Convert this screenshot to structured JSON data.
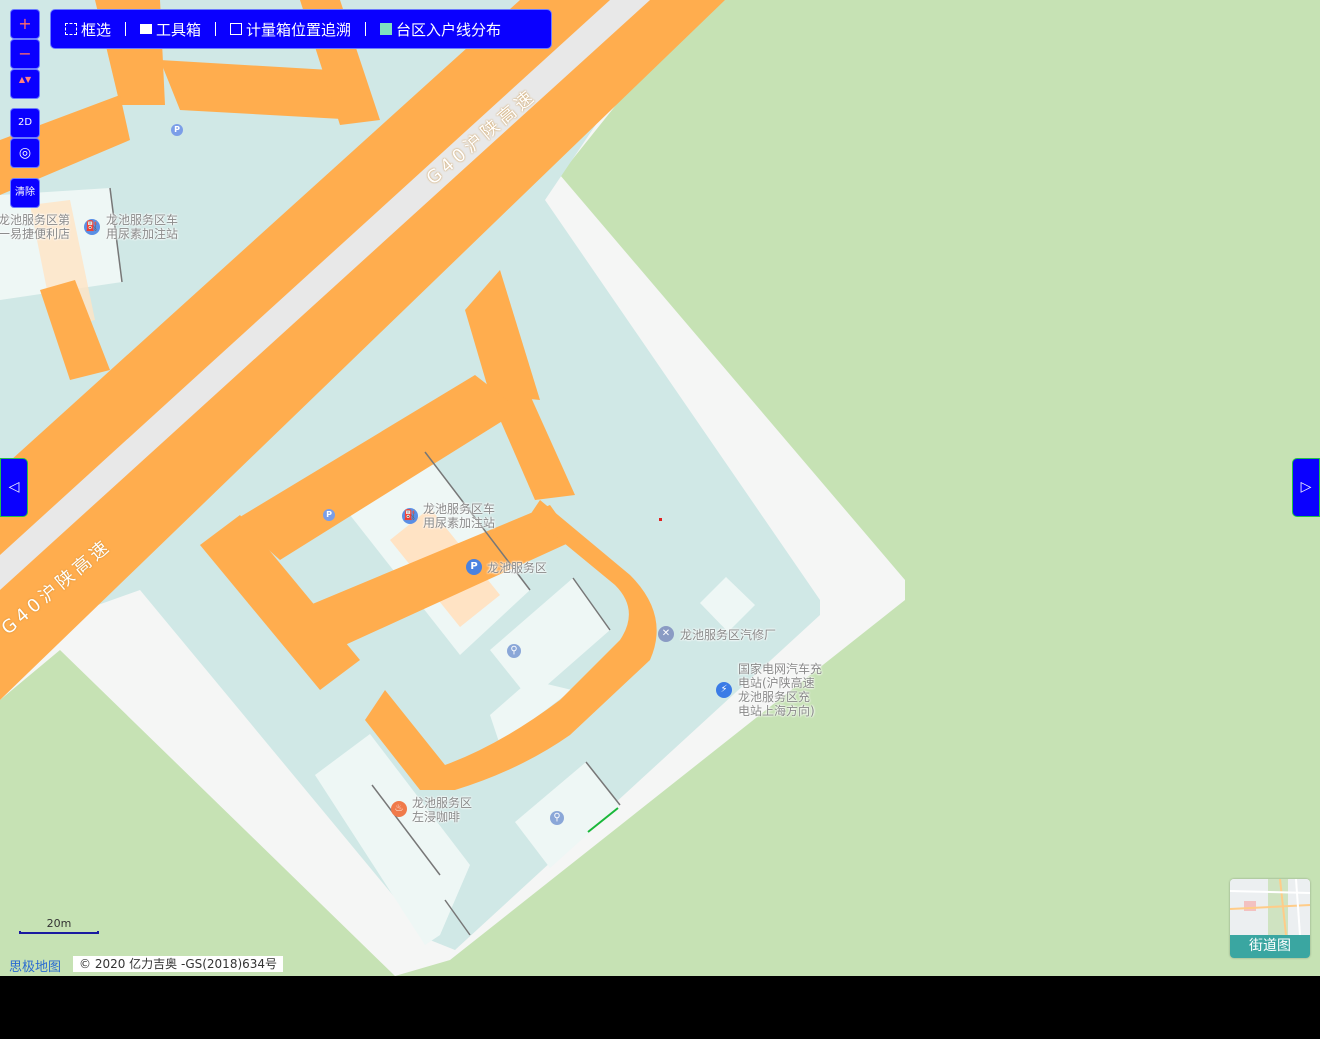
{
  "toolbar": {
    "items": [
      {
        "icon": "select-icon",
        "label": "框选"
      },
      {
        "icon": "toolbox-icon",
        "label": "工具箱"
      },
      {
        "icon": "meter-box-icon",
        "label": "计量箱位置追溯"
      },
      {
        "icon": "grid-icon",
        "label": "台区入户线分布"
      }
    ]
  },
  "controls": {
    "zoom_in_symbol": "+",
    "zoom_out_symbol": "−",
    "compass_symbol": "▲▼",
    "view_2d_label": "2D",
    "locate_symbol": "◎",
    "clear_label": "清除"
  },
  "road_labels": [
    {
      "text": "G40沪陕高速"
    },
    {
      "text": "G40沪陕高速"
    }
  ],
  "pois": [
    {
      "label": "龙池服务区第\n一易捷便利店",
      "icon": "shop-icon"
    },
    {
      "label": "龙池服务区车\n用尿素加注站",
      "icon": "fuel-icon"
    },
    {
      "label": "龙池服务区车\n用尿素加注站",
      "icon": "fuel-icon"
    },
    {
      "label": "龙池服务区",
      "icon": "parking-icon"
    },
    {
      "label": "龙池服务区汽修厂",
      "icon": "repair-icon"
    },
    {
      "label": "国家电网汽车充\n电站(沪陕高速\n龙池服务区充\n电站上海方向)",
      "icon": "charging-icon"
    },
    {
      "label": "龙池服务区\n左浸咖啡",
      "icon": "cafe-icon"
    }
  ],
  "small_markers": {
    "parking": "P",
    "toilet": "⚲"
  },
  "side_arrows": {
    "left": "◁",
    "right": "▷"
  },
  "scale_bar": {
    "label": "20m"
  },
  "map_switch": {
    "label": "街道图"
  },
  "footer": {
    "brand": "思极地图",
    "copyright": "© 2020 亿力吉奥 -GS(2018)634号"
  },
  "colors": {
    "land": "#c6e2b4",
    "service_area": "#d0e8e6",
    "road": "#ffad4e",
    "expressway_center": "#e8e8e8",
    "pavement": "#f5f6f5",
    "building": "#eef7f5",
    "control_blue": "#0a00ff"
  }
}
